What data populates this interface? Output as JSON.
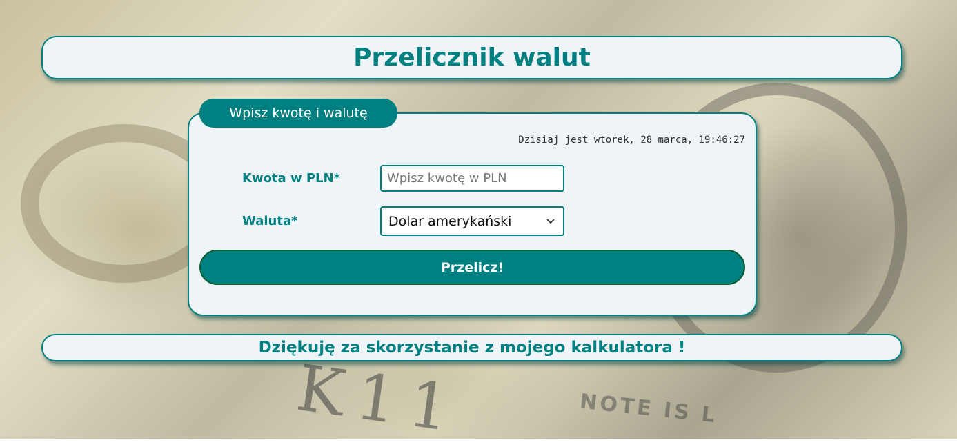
{
  "header": {
    "title": "Przelicznik walut"
  },
  "form": {
    "legend": "Wpisz kwotę i walutę",
    "clock_text": "Dzisiaj jest wtorek, 28 marca, 19:46:27",
    "amount_label": "Kwota w PLN*",
    "amount_placeholder": "Wpisz kwotę w PLN",
    "amount_value": "",
    "currency_label": "Waluta*",
    "currency_selected": "Dolar amerykański",
    "submit_label": "Przelicz!"
  },
  "footer": {
    "text": "Dziękuję za skorzystanie z mojego kalkulatora !"
  },
  "background": {
    "letters": "K11",
    "note_text": "NOTE IS L"
  },
  "colors": {
    "accent": "#008080",
    "panel_bg": "#eef4f8",
    "button_border": "#0a5c2e"
  },
  "icons": {
    "select_arrow": "chevron-down-icon"
  }
}
